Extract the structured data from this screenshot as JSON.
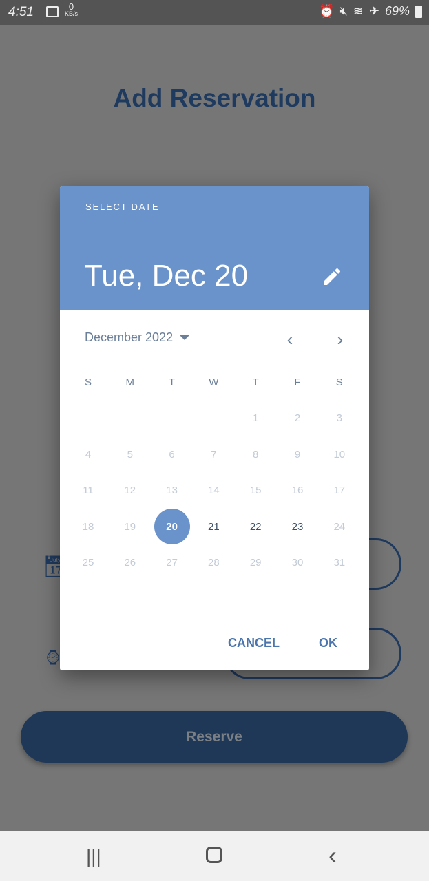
{
  "status_bar": {
    "time": "4:51",
    "net_speed": "0",
    "net_unit": "KB/s",
    "battery": "69%",
    "icons": [
      "image-icon",
      "alarm-icon",
      "mute-icon",
      "wifi-icon",
      "airplane-icon",
      "battery-icon"
    ]
  },
  "page": {
    "title": "Add Reservation",
    "reserve_label": "Reserve",
    "field_icons": [
      "calendar-icon",
      "watch-icon"
    ]
  },
  "dialog": {
    "header_label": "SELECT DATE",
    "selected_date": "Tue, Dec 20",
    "month_year": "December 2022",
    "weekdays": [
      "S",
      "M",
      "T",
      "W",
      "T",
      "F",
      "S"
    ],
    "first_weekday_index": 4,
    "days_in_month": 31,
    "selected_day": 20,
    "enabled_days": [
      20,
      21,
      22,
      23
    ],
    "cancel_label": "CANCEL",
    "ok_label": "OK"
  },
  "colors": {
    "accent": "#6a93cb",
    "primary": "#1f3a5f"
  }
}
